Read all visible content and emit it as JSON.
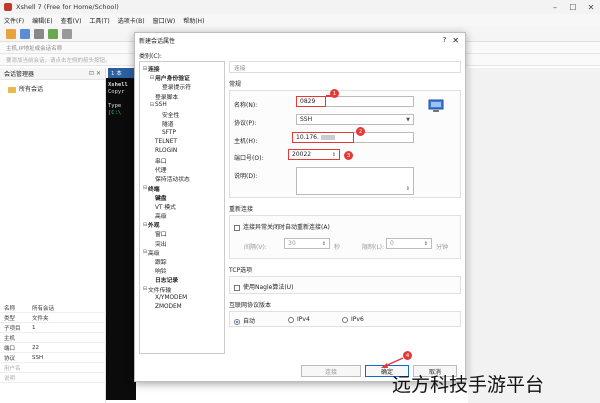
{
  "app": {
    "title": "Xshell 7 (Free for Home/School)",
    "menu": [
      "文件(F)",
      "编辑(E)",
      "查看(V)",
      "工具(T)",
      "选项卡(B)",
      "窗口(W)",
      "帮助(H)"
    ],
    "address_hint": "主机,IP地址或会话名称",
    "tip_hint": "要添加当前会话，请点击左侧的箭头按钮。"
  },
  "session_manager": {
    "title": "会话管理器",
    "tree_root": "所有会话",
    "properties": [
      {
        "k": "名称",
        "v": "所有会话"
      },
      {
        "k": "类型",
        "v": "文件夹"
      },
      {
        "k": "子项目",
        "v": "1"
      },
      {
        "k": "主机",
        "v": ""
      },
      {
        "k": "端口",
        "v": "22"
      },
      {
        "k": "协议",
        "v": "SSH"
      },
      {
        "k": "用户名",
        "v": ""
      },
      {
        "k": "说明",
        "v": ""
      }
    ]
  },
  "terminal": {
    "tab": "1 本",
    "lines": [
      "Xshell",
      "Copyr",
      "",
      "Type",
      "[C:\\"
    ]
  },
  "dialog": {
    "title": "新建会话属性",
    "help": "?",
    "close": "✕",
    "category_label": "类别(C):",
    "tree": [
      {
        "label": "连接",
        "lvl": 0,
        "tw": "⊟",
        "bold": true
      },
      {
        "label": "用户身份验证",
        "lvl": 1,
        "tw": "⊟",
        "bold": true
      },
      {
        "label": "登录提示符",
        "lvl": 2,
        "tw": "",
        "bold": false
      },
      {
        "label": "登录脚本",
        "lvl": 1,
        "tw": "",
        "bold": false
      },
      {
        "label": "SSH",
        "lvl": 1,
        "tw": "⊟",
        "bold": false
      },
      {
        "label": "安全性",
        "lvl": 2,
        "tw": "",
        "bold": false
      },
      {
        "label": "隧道",
        "lvl": 2,
        "tw": "",
        "bold": false
      },
      {
        "label": "SFTP",
        "lvl": 2,
        "tw": "",
        "bold": false
      },
      {
        "label": "TELNET",
        "lvl": 1,
        "tw": "",
        "bold": false
      },
      {
        "label": "RLOGIN",
        "lvl": 1,
        "tw": "",
        "bold": false
      },
      {
        "label": "串口",
        "lvl": 1,
        "tw": "",
        "bold": false
      },
      {
        "label": "代理",
        "lvl": 1,
        "tw": "",
        "bold": false
      },
      {
        "label": "保持活动状态",
        "lvl": 1,
        "tw": "",
        "bold": false
      },
      {
        "label": "终端",
        "lvl": 0,
        "tw": "⊟",
        "bold": true
      },
      {
        "label": "键盘",
        "lvl": 1,
        "tw": "",
        "bold": true
      },
      {
        "label": "VT 模式",
        "lvl": 1,
        "tw": "",
        "bold": false
      },
      {
        "label": "高级",
        "lvl": 1,
        "tw": "",
        "bold": false
      },
      {
        "label": "外观",
        "lvl": 0,
        "tw": "⊟",
        "bold": true
      },
      {
        "label": "窗口",
        "lvl": 1,
        "tw": "",
        "bold": false
      },
      {
        "label": "突出",
        "lvl": 1,
        "tw": "",
        "bold": false
      },
      {
        "label": "高级",
        "lvl": 0,
        "tw": "⊟",
        "bold": false
      },
      {
        "label": "跟踪",
        "lvl": 1,
        "tw": "",
        "bold": false
      },
      {
        "label": "响铃",
        "lvl": 1,
        "tw": "",
        "bold": false
      },
      {
        "label": "日志记录",
        "lvl": 1,
        "tw": "",
        "bold": true
      },
      {
        "label": "文件传输",
        "lvl": 0,
        "tw": "⊟",
        "bold": false
      },
      {
        "label": "X/YMODEM",
        "lvl": 1,
        "tw": "",
        "bold": false
      },
      {
        "label": "ZMODEM",
        "lvl": 1,
        "tw": "",
        "bold": false
      }
    ],
    "crumb": "连接",
    "general": {
      "header": "常规",
      "name_label": "名称(N):",
      "name_value": "0829",
      "protocol_label": "协议(P):",
      "protocol_value": "SSH",
      "host_label": "主机(H):",
      "host_value": "10.176.",
      "port_label": "端口号(O):",
      "port_value": "20022",
      "desc_label": "说明(D):"
    },
    "reconnect": {
      "header": "重新连接",
      "checkbox": "连接异常关闭时自动重新连接(A)",
      "interval_label": "间隔(V):",
      "interval_value": "30",
      "interval_unit": "秒",
      "limit_label": "限制(L):",
      "limit_value": "0",
      "limit_unit": "分钟"
    },
    "tcp": {
      "header": "TCP选项",
      "checkbox": "使用Nagle算法(U)"
    },
    "ipver": {
      "header": "互联网协议版本",
      "auto": "自动",
      "v4": "IPv4",
      "v6": "IPv6"
    },
    "buttons": {
      "connect": "连接",
      "ok": "确定",
      "cancel": "取消"
    },
    "callouts": [
      "1",
      "2",
      "3",
      "4"
    ]
  },
  "watermark": "远方科技手游平台",
  "colors": {
    "accent": "#1a66cc",
    "highlight": "#e53935"
  }
}
